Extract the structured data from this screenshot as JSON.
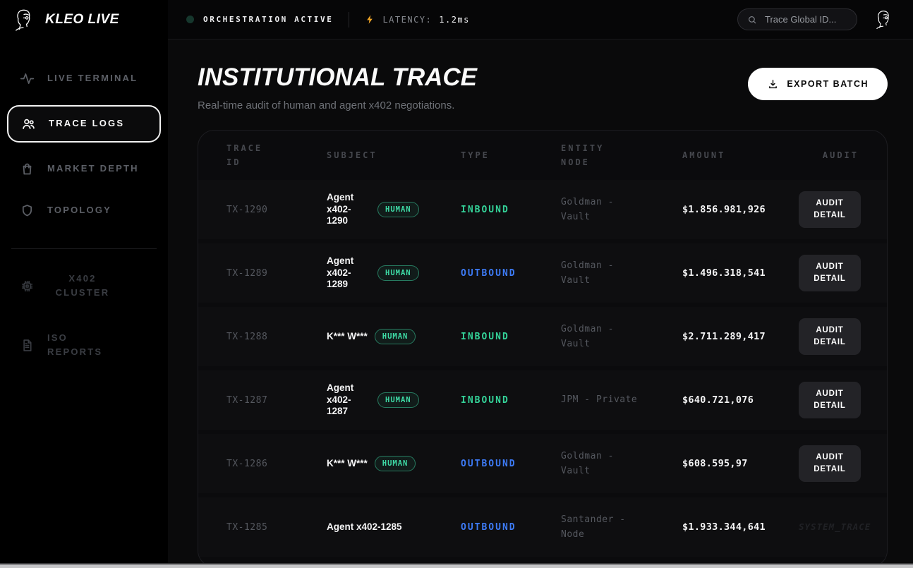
{
  "brand": {
    "name": "KLEO LIVE"
  },
  "topbar": {
    "status": {
      "label": "ORCHESTRATION ACTIVE"
    },
    "latency": {
      "label": "LATENCY:",
      "value": "1.2ms"
    },
    "search": {
      "placeholder": "Trace Global ID..."
    }
  },
  "sidebar": {
    "primary": [
      {
        "label": "LIVE TERMINAL",
        "icon": "activity-icon",
        "active": false
      },
      {
        "label": "TRACE LOGS",
        "icon": "users-icon",
        "active": true
      },
      {
        "label": "MARKET DEPTH",
        "icon": "bag-icon",
        "active": false
      },
      {
        "label": "TOPOLOGY",
        "icon": "shield-icon",
        "active": false
      }
    ],
    "secondary": [
      {
        "label": "X402 CLUSTER",
        "icon": "chip-icon",
        "active": false
      },
      {
        "label": "ISO REPORTS",
        "icon": "document-icon",
        "active": false
      }
    ]
  },
  "main": {
    "title": "INSTITUTIONAL TRACE",
    "subtitle": "Real-time audit of human and agent x402 negotiations.",
    "export_button": "EXPORT BATCH"
  },
  "table": {
    "columns": [
      "TRACE ID",
      "SUBJECT",
      "TYPE",
      "ENTITY NODE",
      "AMOUNT",
      "AUDIT"
    ],
    "rows": [
      {
        "trace_id": "TX-1290",
        "subject": "Agent x402-1290",
        "badge": "HUMAN",
        "type": "INBOUND",
        "entity_node": "Goldman - Vault",
        "amount": "$1.856.981,926",
        "audit": "AUDIT DETAIL"
      },
      {
        "trace_id": "TX-1289",
        "subject": "Agent x402-1289",
        "badge": "HUMAN",
        "type": "OUTBOUND",
        "entity_node": "Goldman - Vault",
        "amount": "$1.496.318,541",
        "audit": "AUDIT DETAIL"
      },
      {
        "trace_id": "TX-1288",
        "subject": "K*** W***",
        "badge": "HUMAN",
        "type": "INBOUND",
        "entity_node": "Goldman - Vault",
        "amount": "$2.711.289,417",
        "audit": "AUDIT DETAIL"
      },
      {
        "trace_id": "TX-1287",
        "subject": "Agent x402-1287",
        "badge": "HUMAN",
        "type": "INBOUND",
        "entity_node": "JPM - Private",
        "amount": "$640.721,076",
        "audit": "AUDIT DETAIL"
      },
      {
        "trace_id": "TX-1286",
        "subject": "K*** W***",
        "badge": "HUMAN",
        "type": "OUTBOUND",
        "entity_node": "Goldman - Vault",
        "amount": "$608.595,97",
        "audit": "AUDIT DETAIL"
      },
      {
        "trace_id": "TX-1285",
        "subject": "Agent x402-1285",
        "badge": null,
        "type": "OUTBOUND",
        "entity_node": "Santander - Node",
        "amount": "$1.933.344,641",
        "audit": "SYSTEM_TRACE"
      }
    ]
  },
  "colors": {
    "accent_green": "#34d399",
    "accent_blue": "#3d7bf7",
    "latency_bolt": "#f0a526",
    "export_button_bg": "#ffffff"
  }
}
